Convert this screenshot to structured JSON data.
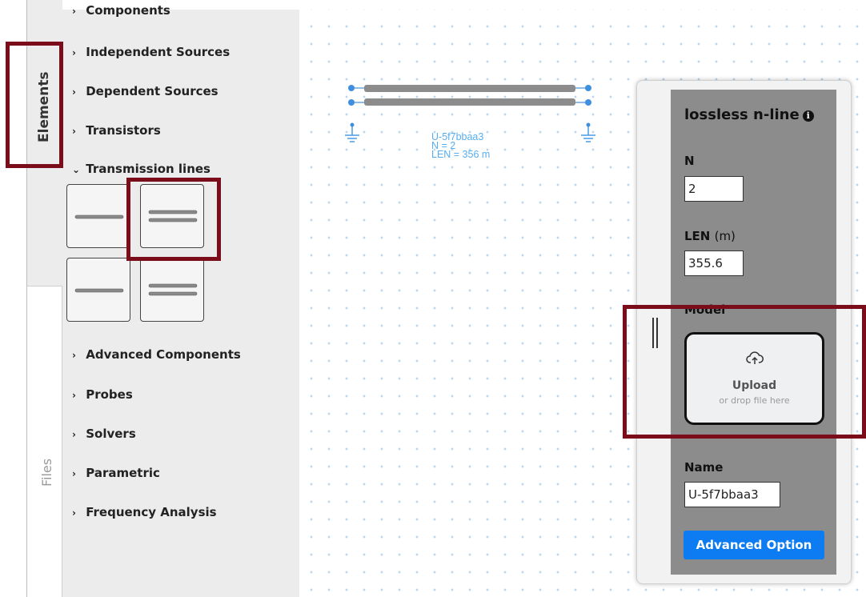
{
  "side_tabs": {
    "elements": "Elements",
    "files": "Files"
  },
  "palette": {
    "items_top": [
      {
        "label": "Components",
        "icon": "chevron-right"
      },
      {
        "label": "Independent Sources",
        "icon": "chevron-right"
      },
      {
        "label": "Dependent Sources",
        "icon": "chevron-right"
      },
      {
        "label": "Transistors",
        "icon": "chevron-right"
      },
      {
        "label": "Transmission lines",
        "icon": "chevron-down"
      }
    ],
    "items_bottom": [
      {
        "label": "Advanced Components",
        "icon": "chevron-right"
      },
      {
        "label": "Probes",
        "icon": "chevron-right"
      },
      {
        "label": "Solvers",
        "icon": "chevron-right"
      },
      {
        "label": "Parametric",
        "icon": "chevron-right"
      },
      {
        "label": "Frequency Analysis",
        "icon": "chevron-right"
      }
    ],
    "chevron_right": "›",
    "chevron_down": "⌄"
  },
  "canvas": {
    "component": {
      "id": "U-5f7bbaa3",
      "n_text": "N = 2",
      "len_text": "LEN = 356 m"
    }
  },
  "properties": {
    "title": "lossless n-line",
    "info_icon": "i",
    "n_label": "N",
    "n_value": "2",
    "len_label": "LEN",
    "len_unit": "(m)",
    "len_value": "355.6",
    "model_label": "Model",
    "upload_label": "Upload",
    "upload_hint": "or drop file here",
    "name_label": "Name",
    "name_value": "U-5f7bbaa3",
    "advanced_button": "Advanced Option"
  },
  "colors": {
    "highlight": "#7b0d1a",
    "accent_blue": "#0d7cf2",
    "canvas_label": "#56aef0"
  }
}
